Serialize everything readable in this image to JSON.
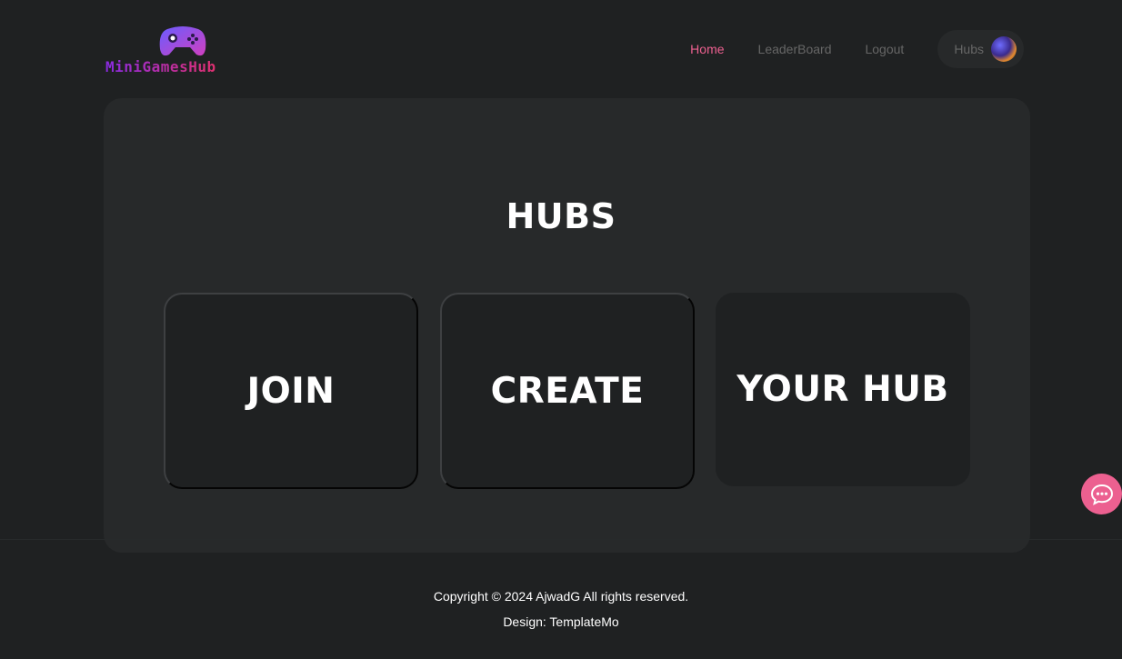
{
  "header": {
    "logo_text": "MiniGamesHub",
    "nav": {
      "home": "Home",
      "leaderboard": "LeaderBoard",
      "logout": "Logout",
      "hubs": "Hubs"
    }
  },
  "main": {
    "title": "HUBS",
    "cards": {
      "join": "JOIN",
      "create": "CREATE",
      "your_hub": "YOUR HUB"
    }
  },
  "footer": {
    "copyright": "Copyright © 2024 AjwadG All rights reserved.",
    "design": "Design: TemplateMo"
  },
  "colors": {
    "background": "#1f2122",
    "panel": "#27292a",
    "accent": "#ec6090",
    "nav_text": "#666666"
  },
  "icons": {
    "logo": "gamepad-icon",
    "chat": "chat-bubble-icon",
    "avatar": "user-avatar"
  }
}
